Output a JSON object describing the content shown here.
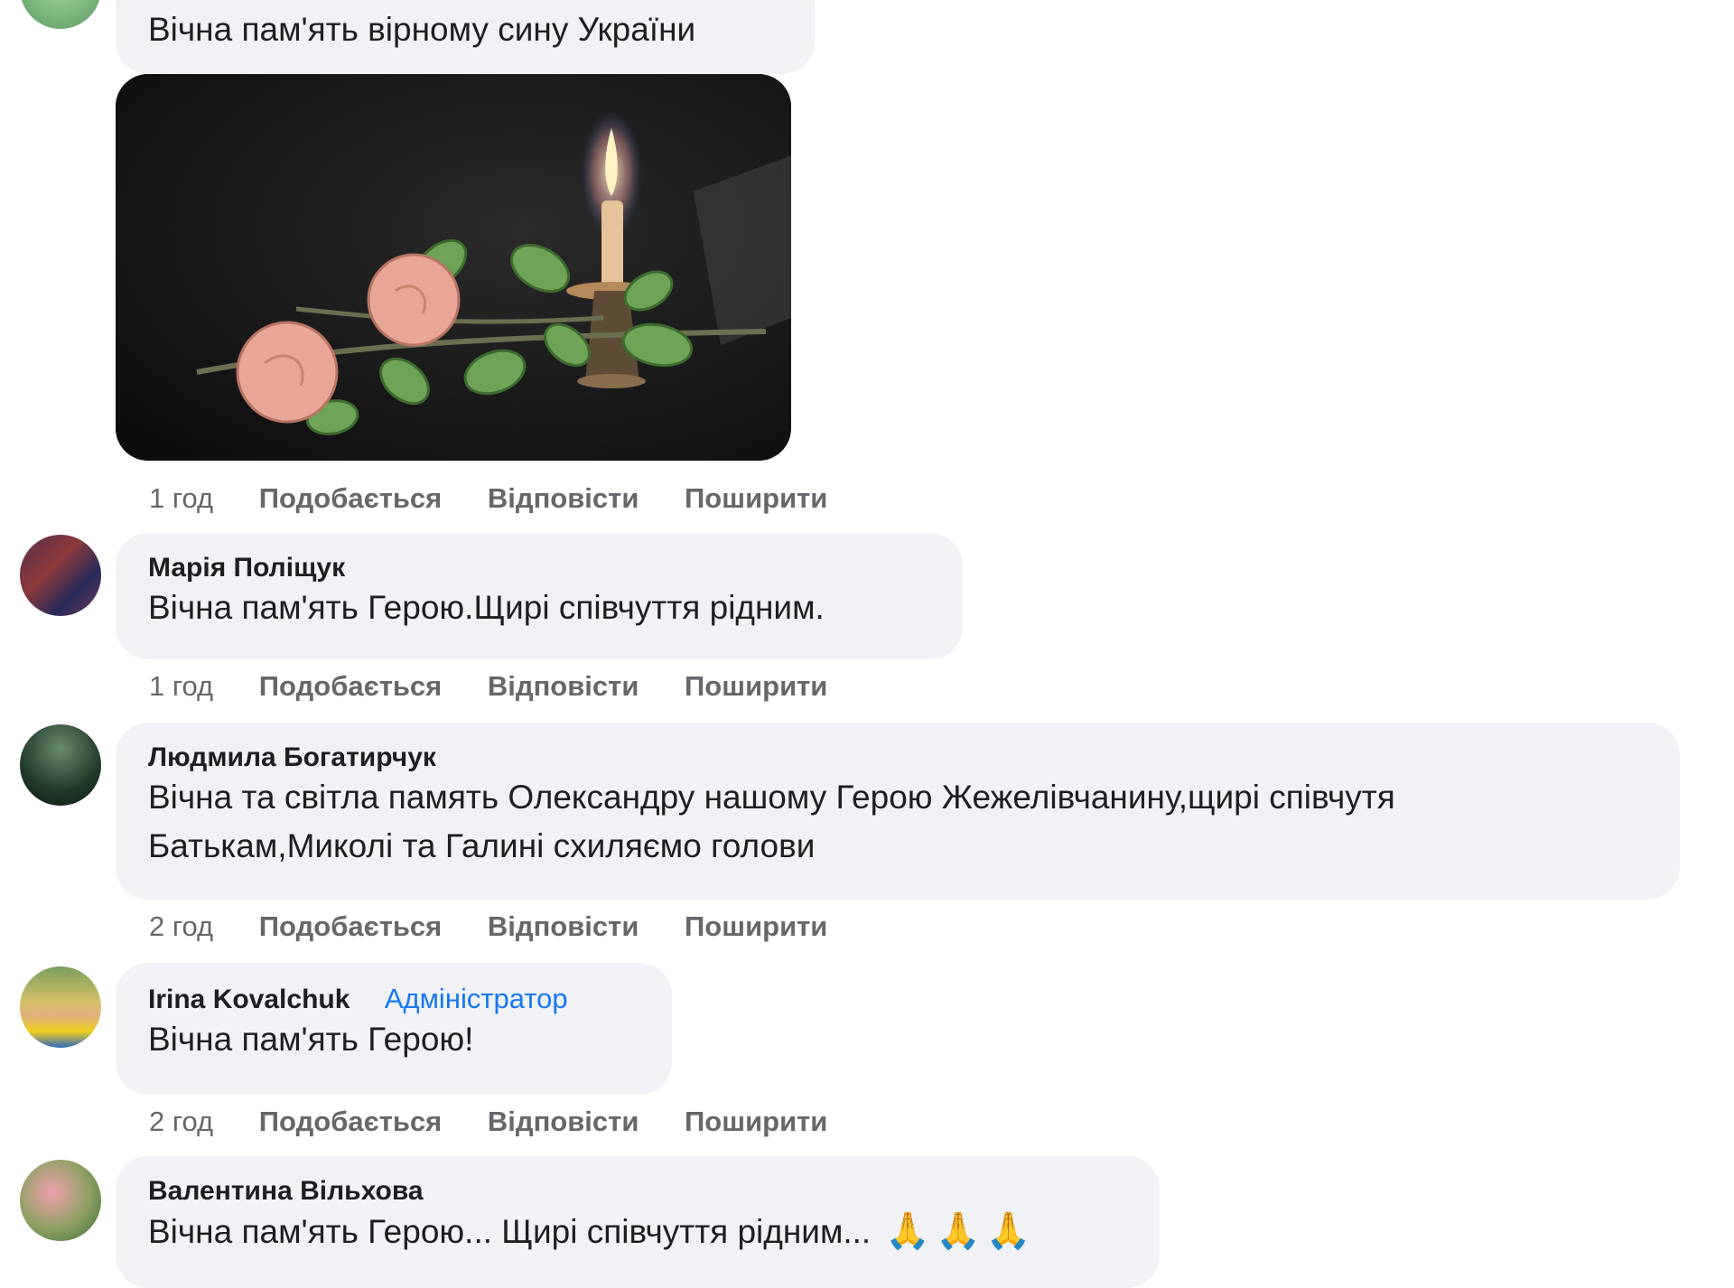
{
  "comments": [
    {
      "text": "Вічна пам'ять вірному сину України",
      "time": "1 год",
      "like": "Подобається",
      "reply": "Відповісти",
      "share": "Поширити"
    },
    {
      "author": "Марія Поліщук",
      "text": "Вічна пам'ять Герою.Щирі співчуття рідним.",
      "time": "1 год",
      "like": "Подобається",
      "reply": "Відповісти",
      "share": "Поширити"
    },
    {
      "author": "Людмила Богатирчук",
      "text_line1": "Вічна та світла память Олександру нашому Герою Жежелівчанину,щирі співчутя",
      "text_line2": "Батькам,Миколі та Галині схиляємо голови",
      "time": "2 год",
      "like": "Подобається",
      "reply": "Відповісти",
      "share": "Поширити"
    },
    {
      "author": "Irina Kovalchuk",
      "badge": "Адміністратор",
      "text": "Вічна пам'ять Герою!",
      "time": "2 год",
      "like": "Подобається",
      "reply": "Відповісти",
      "share": "Поширити"
    },
    {
      "author": "Валентина Вільхова",
      "text": "Вічна пам'ять Герою... Щирі співчуття рідним...",
      "emoji": "🙏🙏🙏"
    }
  ],
  "colors": {
    "bubble": "#f0f2f5",
    "badge": "#1877f2",
    "meta": "#65676b"
  }
}
